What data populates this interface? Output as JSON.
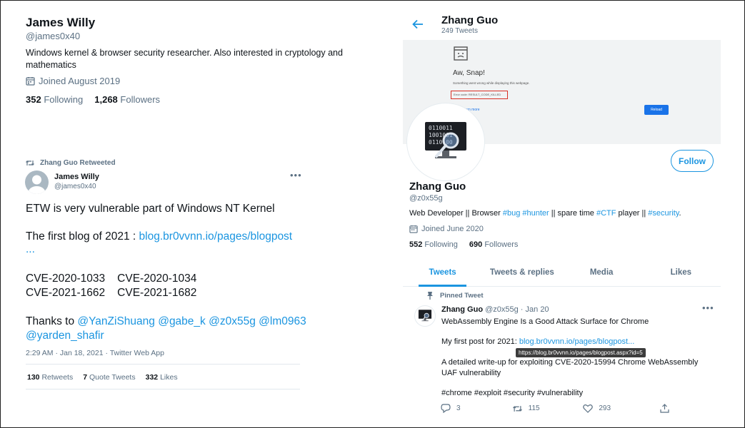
{
  "left_profile": {
    "name": "James Willy",
    "handle": "@james0x40",
    "bio_line1": "Windows kernel & browser security researcher. Also interested in cryptology and",
    "bio_line2": "mathematics",
    "joined": "Joined August 2019",
    "following_count": "352",
    "following_label": "Following",
    "followers_count": "1,268",
    "followers_label": "Followers"
  },
  "retweet": {
    "context": "Zhang Guo Retweeted",
    "author_name": "James Willy",
    "author_handle": "@james0x40",
    "line1": "ETW is very vulnerable part of Windows NT Kernel",
    "line2_text": "The first blog of 2021 : ",
    "line2_link": "blog.br0vvnn.io/pages/blogpost",
    "line2_ellipsis": "...",
    "cve_1": "CVE-2020-1033",
    "cve_2": "CVE-2020-1034",
    "cve_3": "CVE-2021-1662",
    "cve_4": "CVE-2021-1682",
    "thanks_text": "Thanks to ",
    "mention_1": "@YanZiShuang",
    "mention_2": "@gabe_k",
    "mention_3": "@z0x55g",
    "mention_4": "@lm0963",
    "mention_5": "@yarden_shafir",
    "meta": "2:29 AM · Jan 18, 2021 · Twitter Web App",
    "retweets_count": "130",
    "retweets_label": "Retweets",
    "quotes_count": "7",
    "quotes_label": "Quote Tweets",
    "likes_count": "332",
    "likes_label": "Likes"
  },
  "right_profile": {
    "header_name": "Zhang Guo",
    "header_count": "249 Tweets",
    "banner": {
      "title": "Aw, Snap!",
      "message": "Something went wrong while displaying this webpage.",
      "error_code": "Error code: RESULT_CODE_KILLED",
      "learn_more": "Learn more",
      "reload": "Reload"
    },
    "follow_label": "Follow",
    "name": "Zhang Guo",
    "handle": "@z0x55g",
    "bio_1": "Web Developer || Browser ",
    "bio_tag1": "#bug",
    "bio_tag2": "#hunter",
    "bio_2": " || spare time ",
    "bio_tag3": "#CTF",
    "bio_3": " player || ",
    "bio_tag4": "#security",
    "bio_4": ".",
    "joined": "Joined June 2020",
    "following_count": "552",
    "following_label": "Following",
    "followers_count": "690",
    "followers_label": "Followers",
    "tabs": [
      "Tweets",
      "Tweets & replies",
      "Media",
      "Likes"
    ]
  },
  "pinned_tweet": {
    "label": "Pinned Tweet",
    "author_name": "Zhang Guo",
    "author_meta": "@z0x55g · Jan 20",
    "line1": "WebAssembly Engine Is a Good Attack Surface for Chrome",
    "line2_text": "My first post for 2021: ",
    "line2_link": "blog.br0vvnn.io/pages/blogpost...",
    "tooltip": "https://blog.br0vvnn.io/pages/blogpost.aspx?id=5",
    "line3": "A detailed write-up for exploiting CVE-2020-15994 Chrome WebAssembly",
    "line4": "UAF vulnerability",
    "hashtags": "#chrome #exploit #security #vulnerability",
    "replies": "3",
    "retweets": "115",
    "likes": "293"
  },
  "colors": {
    "link": "#1b95e0",
    "muted": "#5b7083",
    "text": "#0f1419"
  },
  "icons": [
    "calendar-icon",
    "retweet-icon",
    "back-arrow-icon",
    "pin-icon",
    "reply-icon",
    "like-icon",
    "share-icon",
    "more-icon",
    "sad-page-icon",
    "binary-magnifier-icon"
  ]
}
